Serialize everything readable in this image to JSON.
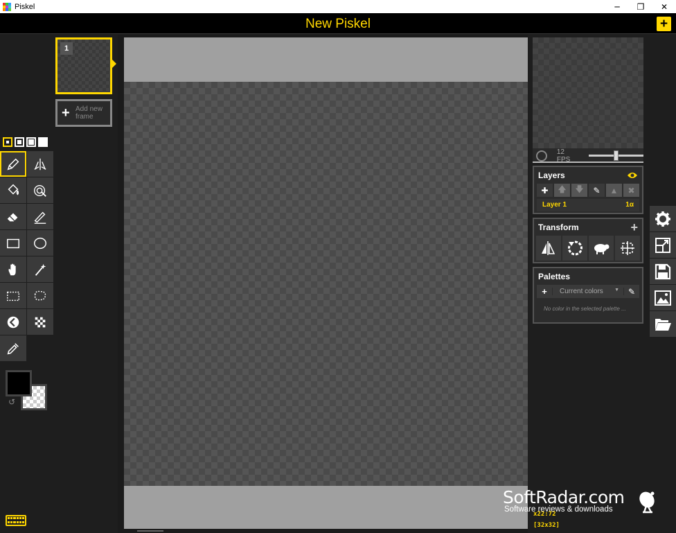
{
  "window": {
    "title": "Piskel",
    "minimize": "─",
    "restore": "❐",
    "close": "✕"
  },
  "header": {
    "piskel_name": "New Piskel",
    "new_button": "+"
  },
  "frames": {
    "items": [
      {
        "number": "1"
      }
    ],
    "add_new": "Add new frame"
  },
  "preview": {
    "fps_label": "12 FPS",
    "fps": 12
  },
  "layers": {
    "title": "Layers",
    "items": [
      {
        "name": "Layer 1",
        "opacity": "1α"
      }
    ]
  },
  "transform": {
    "title": "Transform",
    "add": "+"
  },
  "palettes": {
    "title": "Palettes",
    "selected": "Current colors",
    "empty_message": "No color in the selected palette ..."
  },
  "status": {
    "cursor": "x22:72",
    "canvas_size": "[32x32]"
  },
  "watermark": {
    "main": "SoftRadar.com",
    "sub": "Software reviews & downloads"
  },
  "colors": {
    "accent": "#ffd700",
    "primary": "#000000",
    "background": "#1e1e1e"
  }
}
